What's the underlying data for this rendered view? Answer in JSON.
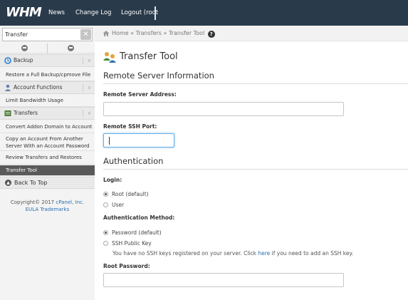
{
  "topbar": {
    "logo": "WHM",
    "news": "News",
    "change_log": "Change Log",
    "logout": "Logout (root"
  },
  "sidebar": {
    "search_value": "Transfer",
    "categories": [
      {
        "label": "Backup",
        "icon": "backup-icon"
      },
      {
        "label": "Account Functions",
        "icon": "account-functions-icon"
      },
      {
        "label": "Transfers",
        "icon": "transfers-icon"
      }
    ],
    "backup_items": [
      "Restore a Full Backup/cpmove File"
    ],
    "account_items": [
      "Limit Bandwidth Usage"
    ],
    "transfer_items": [
      "Convert Addon Domain to Account",
      "Copy an Account From Another",
      "Server With an Account Password",
      "Review Transfers and Restores",
      "Transfer Tool"
    ],
    "back_to_top": "Back To Top",
    "copyright_prefix": "Copyright© 2017",
    "copyright_company": "cPanel, Inc.",
    "eula": "EULA",
    "trademarks": "Trademarks"
  },
  "breadcrumb": {
    "home": "Home",
    "sep1": "»",
    "transfers": "Transfers",
    "sep2": "»",
    "current": "Transfer Tool",
    "help_glyph": "?"
  },
  "main": {
    "title": "Transfer Tool",
    "remote_section": "Remote Server Information",
    "address_label": "Remote Server Address:",
    "address_value": "",
    "port_label": "Remote SSH Port:",
    "port_value": "",
    "auth_section": "Authentication",
    "login_label": "Login:",
    "login_options": [
      {
        "label": "Root (default)",
        "checked": true
      },
      {
        "label": "User",
        "checked": false
      }
    ],
    "method_label": "Authentication Method:",
    "method_options": [
      {
        "label": "Password (default)",
        "checked": true
      },
      {
        "label": "SSH Public Key",
        "checked": false
      }
    ],
    "ssh_note_prefix": "You have no SSH keys registered on your server. Click",
    "ssh_note_link": "here",
    "ssh_note_suffix": "if you need to add an SSH key.",
    "root_password_label": "Root Password:",
    "root_password_value": ""
  }
}
